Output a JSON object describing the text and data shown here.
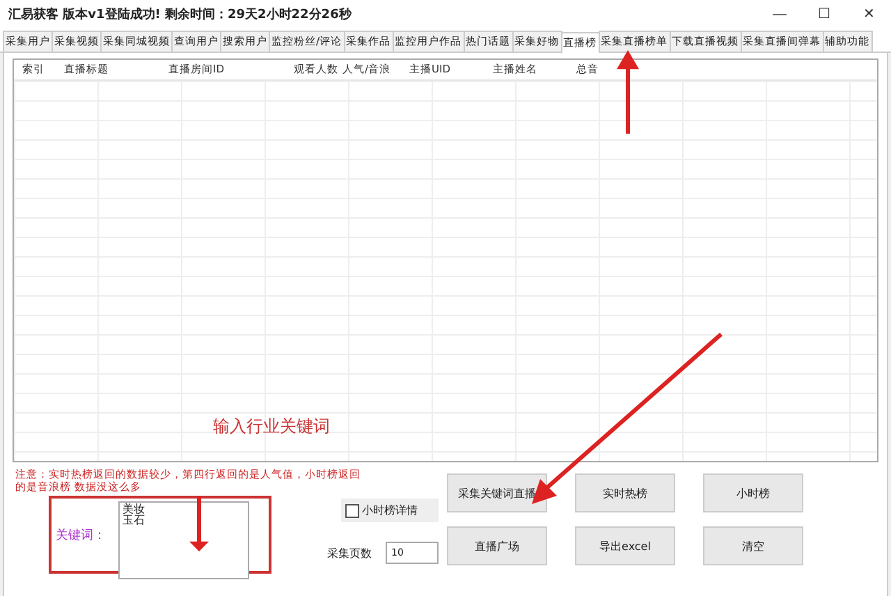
{
  "window": {
    "title": "汇易获客 版本v1登陆成功! 剩余时间：29天2小时22分26秒",
    "controls": [
      "—",
      "☐",
      "✕"
    ]
  },
  "tabs": [
    {
      "label": "采集用户",
      "selected": false
    },
    {
      "label": "采集视频",
      "selected": false
    },
    {
      "label": "采集同城视频",
      "selected": false
    },
    {
      "label": "查询用户",
      "selected": false
    },
    {
      "label": "搜索用户",
      "selected": false
    },
    {
      "label": "监控粉丝/评论",
      "selected": false
    },
    {
      "label": "采集作品",
      "selected": false
    },
    {
      "label": "监控用户作品",
      "selected": false
    },
    {
      "label": "热门话题",
      "selected": false
    },
    {
      "label": "采集好物",
      "selected": false
    },
    {
      "label": "直播榜",
      "selected": true
    },
    {
      "label": "采集直播榜单",
      "selected": false
    },
    {
      "label": "下载直播视频",
      "selected": false
    },
    {
      "label": "采集直播间弹幕",
      "selected": false
    },
    {
      "label": "辅助功能",
      "selected": false
    }
  ],
  "table": {
    "columns": [
      "索引",
      "直播标题",
      "直播房间ID",
      "观看人数",
      "人气/音浪",
      "主播UID",
      "主播姓名",
      "总音"
    ]
  },
  "notice": "注意：实时热榜返回的数据较少，第四行返回的是人气值，小时榜返回的是音浪榜   数据没这么多",
  "keywords": {
    "label": "关键词：",
    "lines": [
      "美妆",
      "玉石"
    ]
  },
  "hour_detail": {
    "label": "小时榜详情",
    "checked": false
  },
  "pages": {
    "label": "采集页数",
    "value": "10"
  },
  "buttons": [
    [
      "采集关键词直播",
      "实时热榜",
      "小时榜"
    ],
    [
      "直播广场",
      "导出excel",
      "清空"
    ]
  ],
  "annotation": {
    "text": "输入行业关键词"
  }
}
